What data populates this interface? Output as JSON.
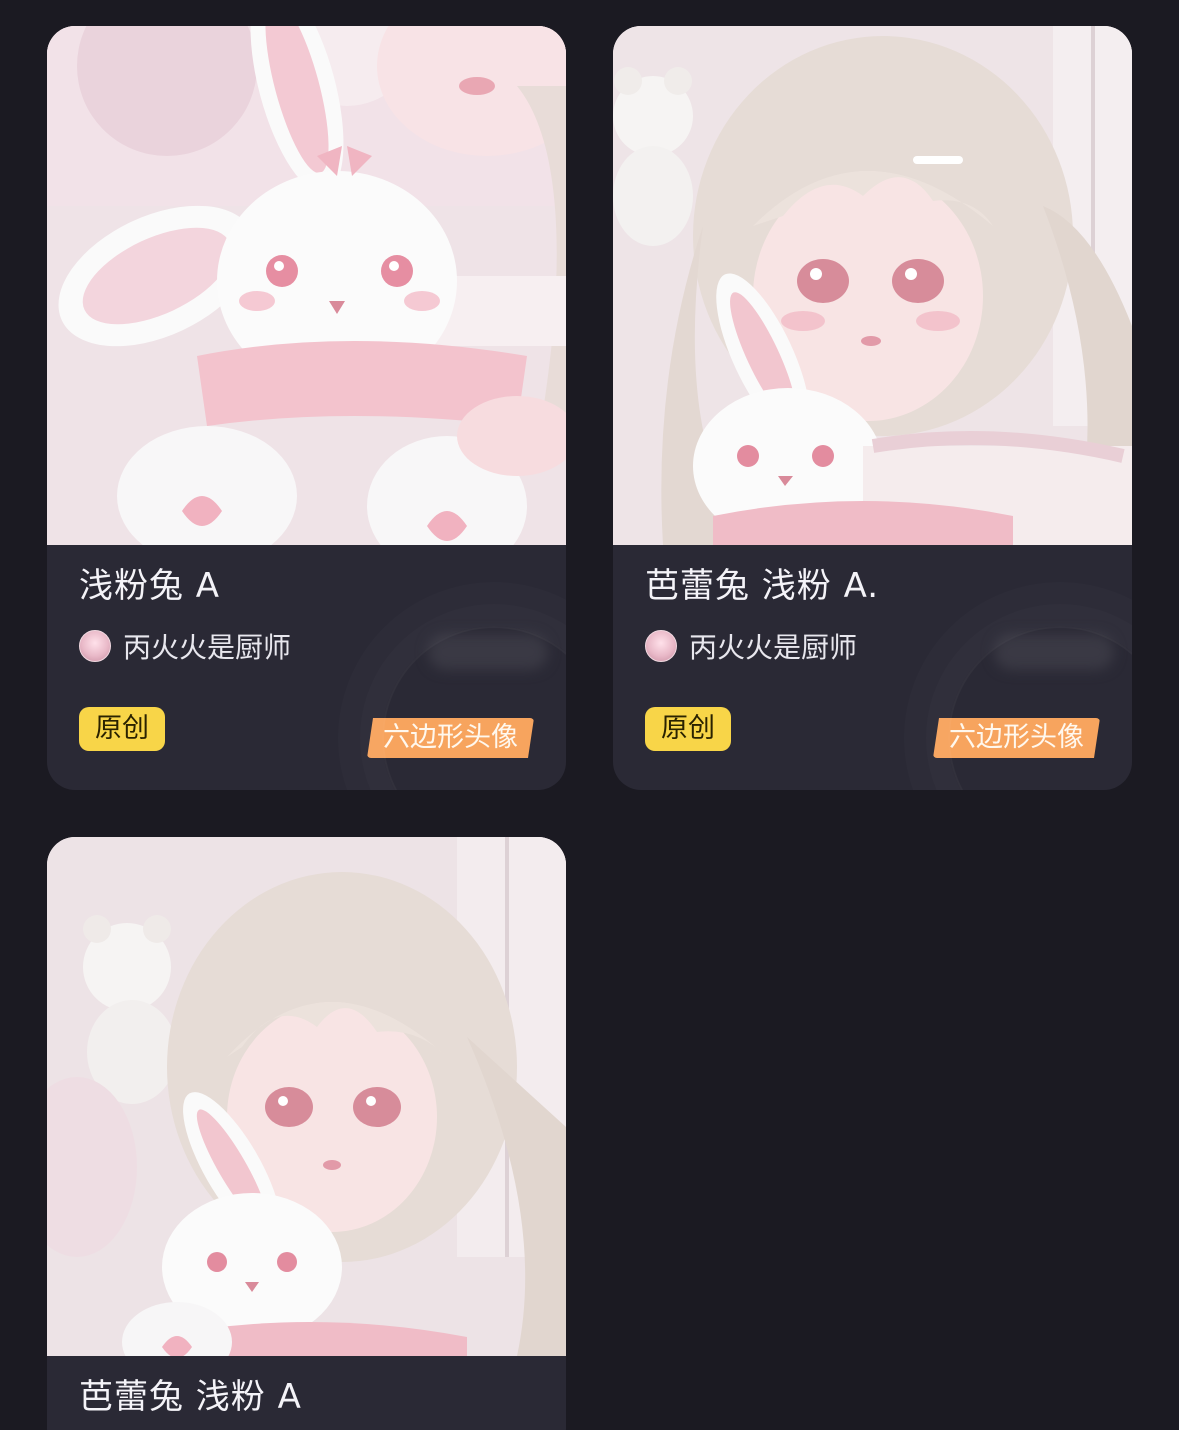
{
  "cards": [
    {
      "title": "浅粉兔 A",
      "author": "丙火火是厨师",
      "badge_original": "原创",
      "badge_type": "六边形头像",
      "art": "anime-girl-with-white-bunny-plush-closeup"
    },
    {
      "title": "芭蕾兔 浅粉 A.",
      "author": "丙火火是厨师",
      "badge_original": "原创",
      "badge_type": "六边形头像",
      "art": "anime-girl-silver-hair-holding-bunny"
    },
    {
      "title": "芭蕾兔 浅粉 A",
      "art": "anime-girl-silver-hair-holding-bunny"
    }
  ],
  "colors": {
    "page_bg": "#1b1a22",
    "card_bg": "#2a2935",
    "badge_original": "#f8d548",
    "badge_type": "#f7a45e"
  }
}
